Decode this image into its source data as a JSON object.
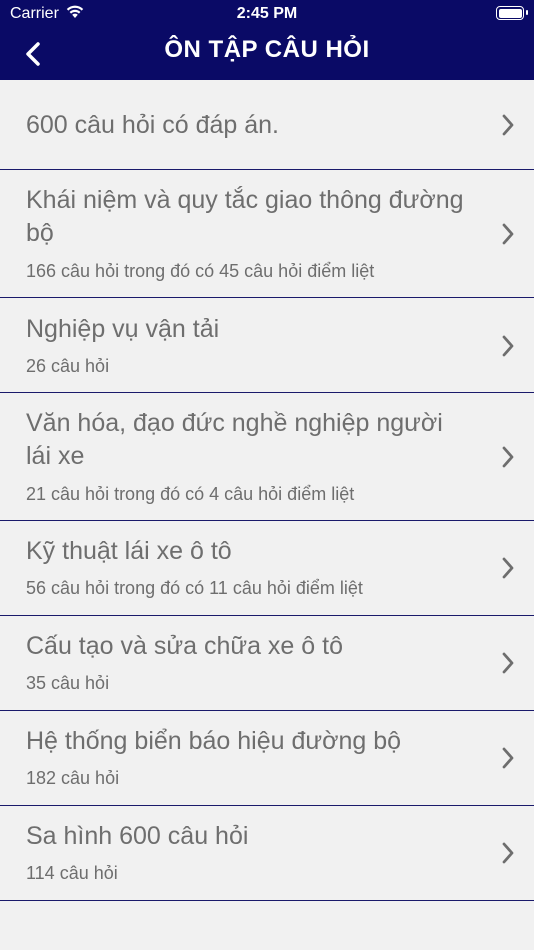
{
  "status_bar": {
    "carrier": "Carrier",
    "time": "2:45 PM"
  },
  "nav": {
    "title": "ÔN TẬP CÂU HỎI"
  },
  "colors": {
    "header_bg": "#0a0a66",
    "list_bg": "#f1f1f1",
    "divider": "#1a1a6b",
    "text": "#6e6e6e"
  },
  "items": [
    {
      "title": "600 câu hỏi có đáp án.",
      "subtitle": ""
    },
    {
      "title": "Khái niệm và quy tắc giao thông đường bộ",
      "subtitle": "166 câu hỏi trong đó có 45 câu hỏi điểm liệt"
    },
    {
      "title": "Nghiệp vụ vận tải",
      "subtitle": "26 câu hỏi"
    },
    {
      "title": "Văn hóa, đạo đức nghề nghiệp người lái xe",
      "subtitle": "21 câu hỏi trong đó có 4 câu hỏi điểm liệt"
    },
    {
      "title": "Kỹ thuật lái xe ô tô",
      "subtitle": "56 câu hỏi trong đó có 11 câu hỏi điểm liệt"
    },
    {
      "title": "Cấu tạo và sửa chữa xe ô tô",
      "subtitle": "35 câu hỏi"
    },
    {
      "title": "Hệ thống biển báo hiệu đường bộ",
      "subtitle": "182 câu hỏi"
    },
    {
      "title": "Sa hình 600 câu hỏi",
      "subtitle": "114 câu hỏi"
    }
  ]
}
